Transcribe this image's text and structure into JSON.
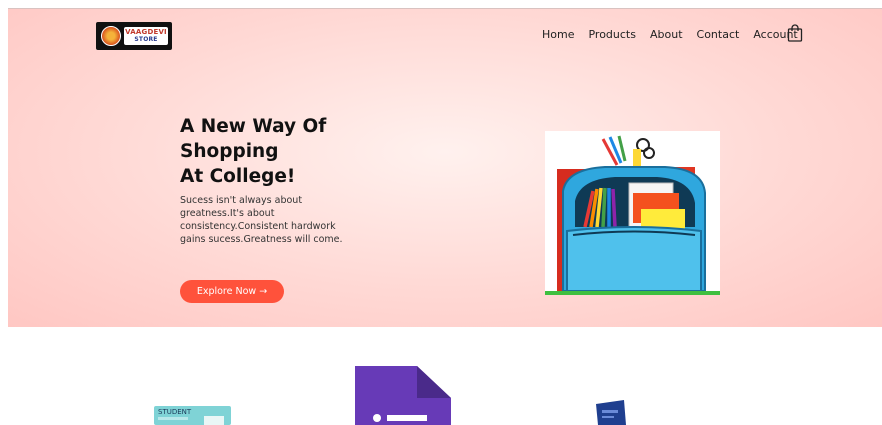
{
  "brand": {
    "logo_line1": "VAAGDEVI",
    "logo_line2": "STORE"
  },
  "nav": {
    "items": [
      "Home",
      "Products",
      "About",
      "Contact",
      "Account"
    ],
    "cart_icon": "shopping-bag-icon"
  },
  "hero": {
    "title_line1": "A New Way Of",
    "title_line2": "Shopping",
    "title_line3": "At College!",
    "subtitle": "Sucess isn't always about greatness.It's about consistency.Consistent hardwork gains sucess.Greatness will come.",
    "cta_label": "Explore Now →",
    "image": "school-backpack"
  },
  "featured": {
    "items": [
      {
        "icon": "student-id-card",
        "label": "STUDENT"
      },
      {
        "icon": "google-forms-icon"
      },
      {
        "icon": "blue-book-icon"
      }
    ]
  },
  "colors": {
    "accent": "#ff523b",
    "hero_bg": "#ffd6d2",
    "forms_purple": "#673ab7"
  }
}
